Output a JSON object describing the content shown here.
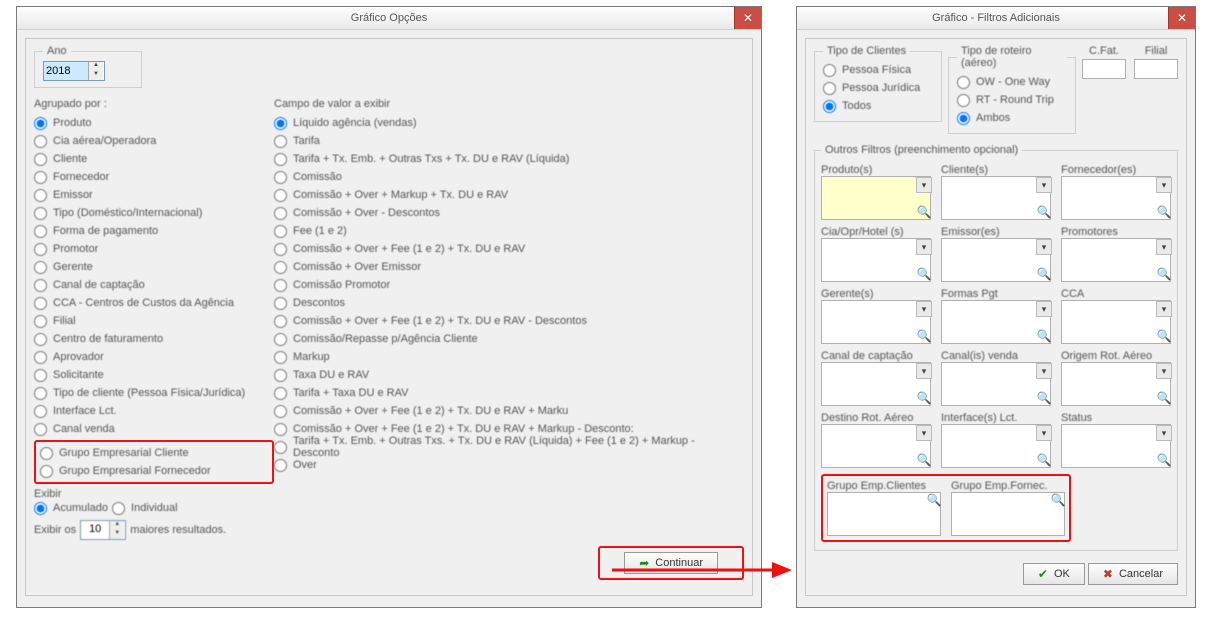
{
  "window1": {
    "title": "Gráfico Opções",
    "ano_label": "Ano",
    "ano_value": "2018",
    "agrupado_label": "Agrupado por :",
    "agrupado_items": [
      "Produto",
      "Cia aérea/Operadora",
      "Cliente",
      "Fornecedor",
      "Emissor",
      "Tipo (Doméstico/Internacional)",
      "Forma de pagamento",
      "Promotor",
      "Gerente",
      "Canal de captação",
      "CCA - Centros de Custos da Agência",
      "Filial",
      "Centro de faturamento",
      "Aprovador",
      "Solicitante",
      "Tipo de cliente (Pessoa Física/Jurídica)",
      "Interface Lct.",
      "Canal venda"
    ],
    "agrupado_extra": [
      "Grupo Empresarial Cliente",
      "Grupo Empresarial Fornecedor"
    ],
    "campo_label": "Campo de valor a exibir",
    "campo_items": [
      "Líquido agência (vendas)",
      "Tarifa",
      "Tarifa + Tx. Emb. + Outras Txs + Tx. DU e RAV (Líquida)",
      "Comissão",
      "Comissão + Over + Markup + Tx. DU e RAV",
      "Comissão + Over - Descontos",
      "Fee (1 e 2)",
      "Comissão + Over + Fee (1 e 2) + Tx. DU e RAV",
      "Comissão + Over Emissor",
      "Comissão Promotor",
      "Descontos",
      "Comissão + Over + Fee (1 e 2) + Tx. DU e RAV - Descontos",
      "Comissão/Repasse p/Agência Cliente",
      "Markup",
      "Taxa DU e RAV",
      "Tarifa + Taxa DU e RAV",
      "Comissão + Over + Fee (1 e 2) + Tx. DU e RAV + Marku",
      "Comissão + Over + Fee (1 e 2) + Tx. DU e RAV + Markup - Desconto:",
      "Tarifa + Tx. Emb. + Outras Txs. + Tx. DU e RAV (Líquida) + Fee (1 e 2) + Markup - Desconto",
      "Over"
    ],
    "exibir_label": "Exibir",
    "exibir_opts": [
      "Acumulado",
      "Individual"
    ],
    "exibir_os": "Exibir os",
    "exibir_n": "10",
    "exibir_tail": "maiores resultados.",
    "continuar": "Continuar"
  },
  "window2": {
    "title": "Gráfico - Filtros Adicionais",
    "tipo_clientes": "Tipo de Clientes",
    "tipo_clientes_opts": [
      "Pessoa Física",
      "Pessoa Jurídica",
      "Todos"
    ],
    "tipo_roteiro": "Tipo de roteiro (aéreo)",
    "tipo_roteiro_opts": [
      "OW - One Way",
      "RT - Round Trip",
      "Ambos"
    ],
    "cfat": "C.Fat.",
    "filial": "Filial",
    "outros": "Outros Filtros (preenchimento opcional)",
    "groups_row1": [
      "Produto(s)",
      "Cliente(s)",
      "Fornecedor(es)"
    ],
    "groups_row2": [
      "Cia/Opr/Hotel (s)",
      "Emissor(es)",
      "Promotores"
    ],
    "groups_row3": [
      "Gerente(s)",
      "Formas Pgt",
      "CCA"
    ],
    "groups_row4": [
      "Canal de captação",
      "Canal(is) venda",
      "Origem Rot. Aéreo"
    ],
    "groups_row5": [
      "Destino Rot. Aéreo",
      "Interface(s) Lct.",
      "Status"
    ],
    "groups_hl": [
      "Grupo Emp.Clientes",
      "Grupo Emp.Fornec."
    ],
    "ok": "OK",
    "cancel": "Cancelar"
  }
}
